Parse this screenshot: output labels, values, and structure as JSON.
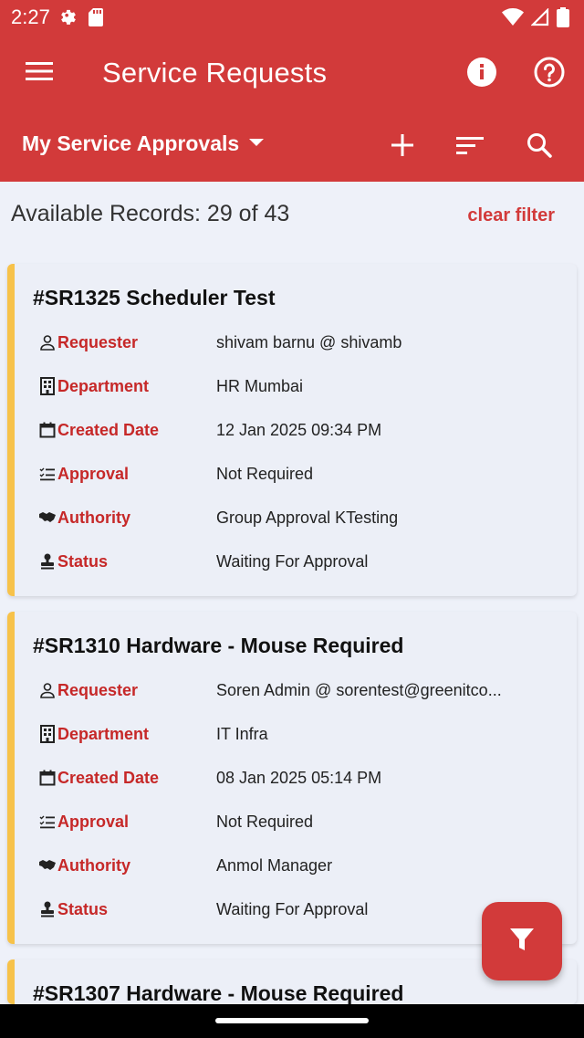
{
  "status_bar": {
    "time": "2:27",
    "left_icons": [
      "settings-gear-icon",
      "sd-card-icon"
    ],
    "right_icons": [
      "wifi-icon",
      "cell-signal-icon",
      "battery-icon"
    ]
  },
  "app_bar": {
    "title": "Service Requests",
    "color": "#d23a3a",
    "actions": [
      "menu-icon",
      "info-icon",
      "help-icon"
    ]
  },
  "toolbar": {
    "view_label": "My Service Approvals",
    "actions": [
      "add-icon",
      "sort-icon",
      "search-icon"
    ]
  },
  "records": {
    "count_text": "Available Records: 29 of 43",
    "clear_filter_label": "clear filter"
  },
  "field_labels": {
    "requester": "Requester",
    "department": "Department",
    "created_date": "Created Date",
    "approval": "Approval",
    "authority": "Authority",
    "status": "Status"
  },
  "cards": [
    {
      "title": "#SR1325 Scheduler Test",
      "requester": "shivam barnu @ shivamb",
      "department": "HR Mumbai",
      "created_date": "12 Jan 2025 09:34 PM",
      "approval": "Not Required",
      "authority": "Group Approval KTesting",
      "status": "Waiting For Approval"
    },
    {
      "title": "#SR1310 Hardware - Mouse Required",
      "requester": "Soren Admin @ sorentest@greenitco...",
      "department": "IT Infra",
      "created_date": "08 Jan 2025 05:14 PM",
      "approval": "Not Required",
      "authority": "Anmol Manager",
      "status": "Waiting For Approval"
    },
    {
      "title": "#SR1307 Hardware - Mouse Required"
    }
  ],
  "accent_color": "#f7c24a",
  "label_color": "#c62828",
  "fab": {
    "icon": "filter-icon"
  }
}
